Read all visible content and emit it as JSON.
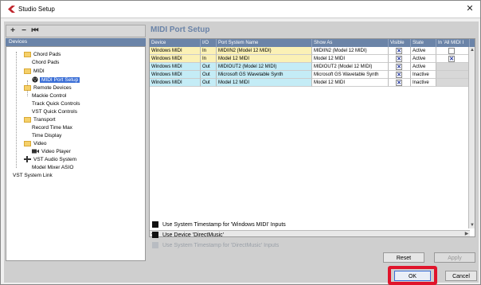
{
  "window": {
    "title": "Studio Setup",
    "close_glyph": "✕",
    "app_icon": "cubase-logo-icon"
  },
  "toolbar": {
    "add": "+",
    "remove": "−",
    "reset": "⏮"
  },
  "devices": {
    "header": "Devices",
    "tree": [
      {
        "label": "Chord Pads",
        "folder": true
      },
      {
        "label": "Chord Pads",
        "folder": false
      },
      {
        "label": "MIDI",
        "folder": true
      },
      {
        "label": "MIDI Port Setup",
        "folder": false,
        "selected": true
      },
      {
        "label": "Remote Devices",
        "folder": true
      },
      {
        "label": "Mackie Control",
        "folder": false
      },
      {
        "label": "Track Quick Controls",
        "folder": false
      },
      {
        "label": "VST Quick Controls",
        "folder": false
      },
      {
        "label": "Transport",
        "folder": true
      },
      {
        "label": "Record Time Max",
        "folder": false
      },
      {
        "label": "Time Display",
        "folder": false
      },
      {
        "label": "Video",
        "folder": true
      },
      {
        "label": "Video Player",
        "folder": false
      },
      {
        "label": "VST Audio System",
        "folder": false
      },
      {
        "label": "Model Mixer ASIO",
        "folder": false
      },
      {
        "label": "VST System Link",
        "folder": false
      }
    ]
  },
  "panel": {
    "title": "MIDI Port Setup",
    "columns": [
      "Device",
      "I/O",
      "Port System Name",
      "Show As",
      "Visible",
      "State",
      "In 'All MIDI I"
    ],
    "rows": [
      {
        "device": "Windows MIDI",
        "io": "In",
        "port": "MIDIIN2 (Model 12 MIDI)",
        "show": "MIDIIN2 (Model 12 MIDI)",
        "visible": "✕",
        "state": "Active",
        "allmidi": "",
        "color": "#fbf1b5"
      },
      {
        "device": "Windows MIDI",
        "io": "In",
        "port": "Model 12 MIDI",
        "show": "Model 12 MIDI",
        "visible": "✕",
        "state": "Active",
        "allmidi": "✕",
        "color": "#fbf1b5"
      },
      {
        "device": "Windows MIDI",
        "io": "Out",
        "port": "MIDIOUT2 (Model 12 MIDI)",
        "show": "MIDIOUT2 (Model 12 MIDI)",
        "visible": "✕",
        "state": "Active",
        "allmidi": "",
        "color": "#c4ecf6"
      },
      {
        "device": "Windows MIDI",
        "io": "Out",
        "port": "Microsoft GS Wavetable Synth",
        "show": "Microsoft GS Wavetable Synth",
        "visible": "✕",
        "state": "Inactive",
        "allmidi": "",
        "color": "#c4ecf6"
      },
      {
        "device": "Windows MIDI",
        "io": "Out",
        "port": "Model 12 MIDI",
        "show": "Model 12 MIDI",
        "visible": "✕",
        "state": "Inactive",
        "allmidi": "",
        "color": "#c4ecf6"
      }
    ]
  },
  "options": [
    {
      "label": "Use System Timestamp for 'Windows MIDI' Inputs",
      "enabled": true
    },
    {
      "label": "Use Device 'DirectMusic'",
      "enabled": true
    },
    {
      "label": "Use System Timestamp for 'DirectMusic' Inputs",
      "enabled": false
    }
  ],
  "buttons": {
    "reset": "Reset",
    "apply": "Apply",
    "ok": "OK",
    "cancel": "Cancel"
  },
  "colors": {
    "accent": "#6b84a8",
    "highlight": "#e0142b",
    "selected": "#3a6ed6"
  }
}
